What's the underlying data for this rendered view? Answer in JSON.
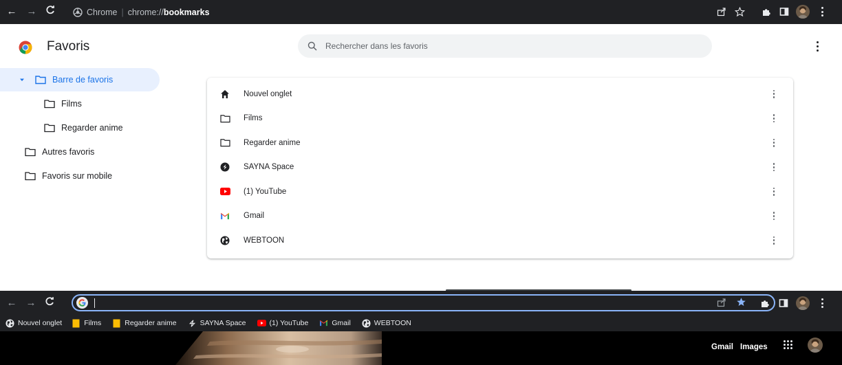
{
  "browser_top": {
    "chip_label": "Chrome",
    "url_scheme": "chrome://",
    "url_host": "bookmarks"
  },
  "manager": {
    "title": "Favoris",
    "search_placeholder": "Rechercher dans les favoris"
  },
  "tree": {
    "items": [
      {
        "label": "Barre de favoris",
        "selected": true,
        "expanded": true,
        "level": 0
      },
      {
        "label": "Films",
        "selected": false,
        "level": 1
      },
      {
        "label": "Regarder anime",
        "selected": false,
        "level": 1
      },
      {
        "label": "Autres favoris",
        "selected": false,
        "level": 0
      },
      {
        "label": "Favoris sur mobile",
        "selected": false,
        "level": 0
      }
    ]
  },
  "list": {
    "items": [
      {
        "label": "Nouvel onglet",
        "icon": "home-icon"
      },
      {
        "label": "Films",
        "icon": "folder-icon"
      },
      {
        "label": "Regarder anime",
        "icon": "folder-icon"
      },
      {
        "label": "SAYNA Space",
        "icon": "sayna-icon"
      },
      {
        "label": "(1) YouTube",
        "icon": "youtube-icon"
      },
      {
        "label": "Gmail",
        "icon": "gmail-icon"
      },
      {
        "label": "WEBTOON",
        "icon": "globe-icon"
      }
    ]
  },
  "browser_bottom": {
    "omnibox_value": "",
    "bookmarks_bar": [
      {
        "label": "Nouvel onglet",
        "icon": "globe-icon"
      },
      {
        "label": "Films",
        "icon": "folder-icon"
      },
      {
        "label": "Regarder anime",
        "icon": "folder-icon"
      },
      {
        "label": "SAYNA Space",
        "icon": "sayna-icon"
      },
      {
        "label": "(1) YouTube",
        "icon": "youtube-icon"
      },
      {
        "label": "Gmail",
        "icon": "gmail-icon"
      },
      {
        "label": "WEBTOON",
        "icon": "globe-icon"
      }
    ],
    "gmail_link": "Gmail",
    "images_link": "Images"
  },
  "colors": {
    "accent": "#1a73e8",
    "selected_bg": "#e8f0fe",
    "chrome_dark": "#202124",
    "focus_ring": "#8ab4f8",
    "youtube_red": "#ff0000",
    "star_blue": "#8ab4f8"
  }
}
